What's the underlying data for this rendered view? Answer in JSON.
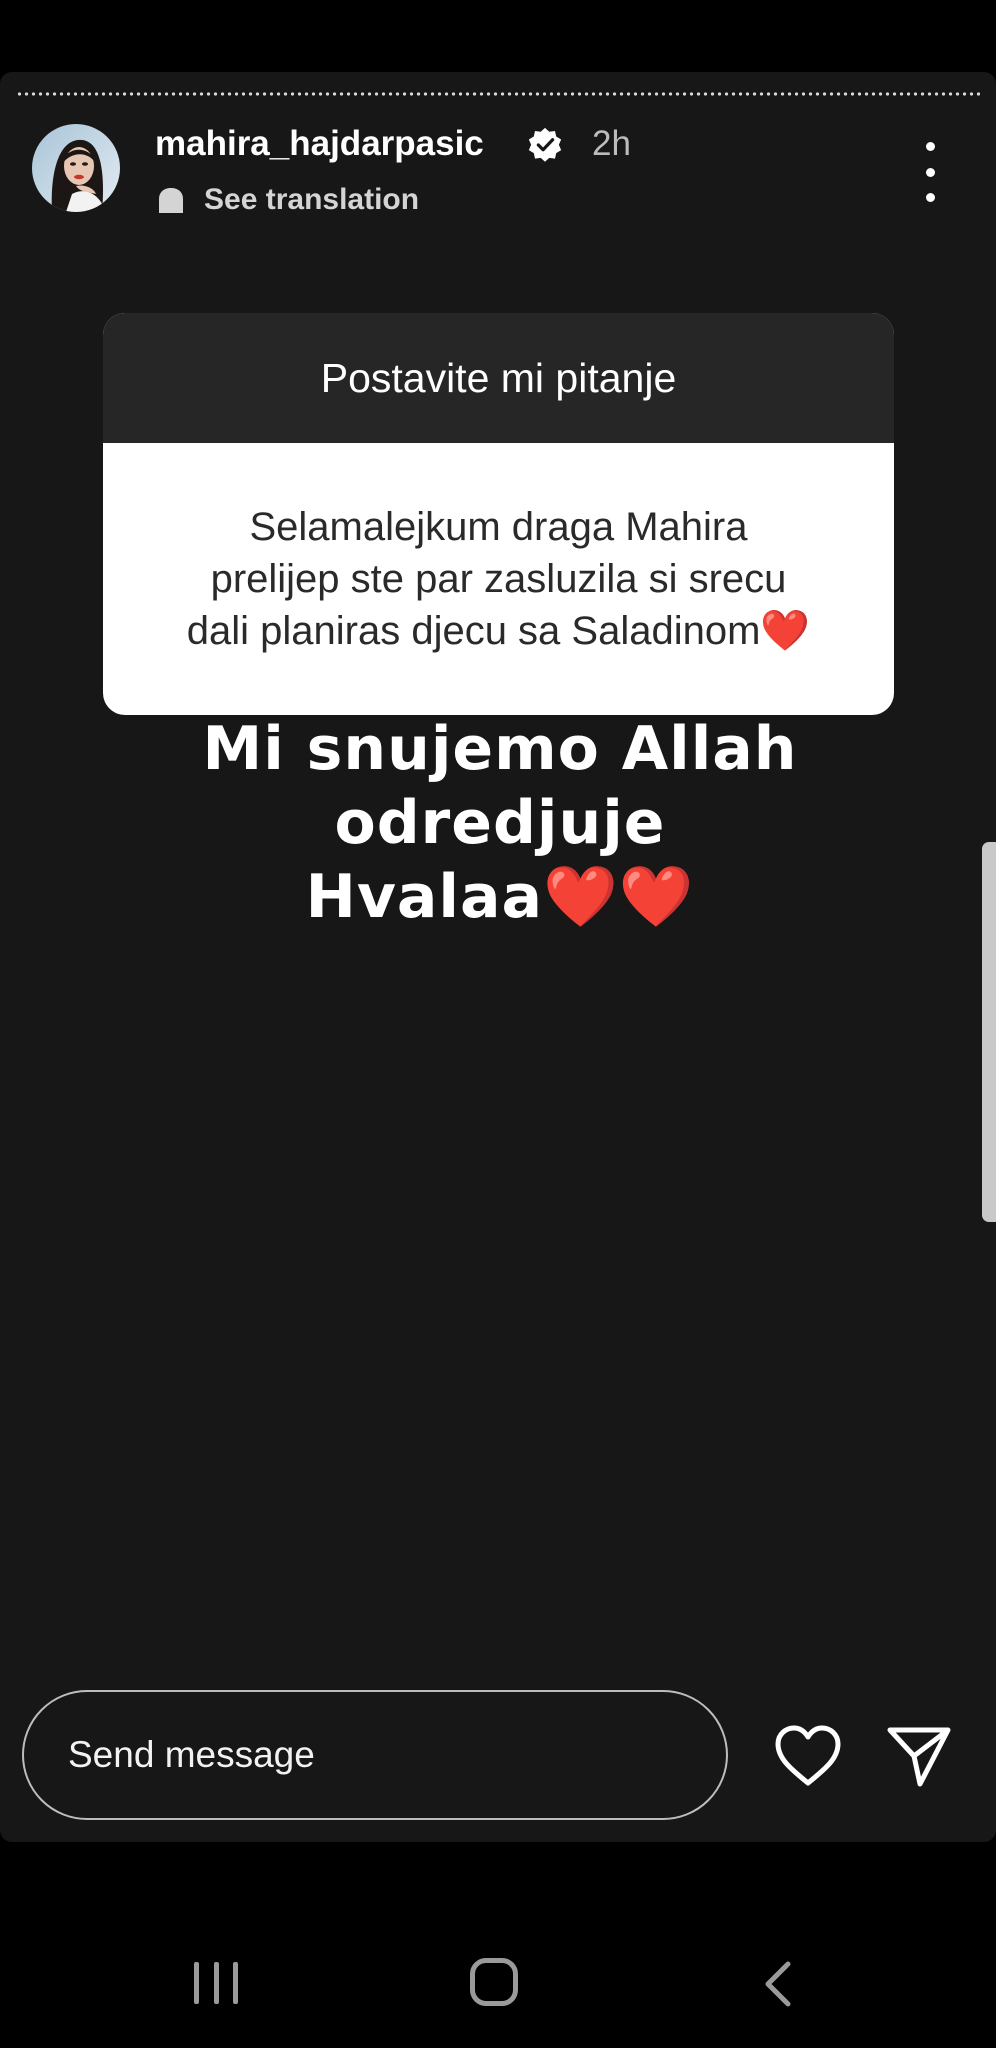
{
  "header": {
    "username": "mahira_hajdarpasic",
    "time": "2h",
    "translation_label": "See translation",
    "menu_icon": "more-vertical-icon",
    "verified_icon": "verified-badge-icon"
  },
  "question_sticker": {
    "title": "Postavite mi pitanje",
    "question_lines": [
      "Selamalejkum draga Mahira",
      "prelijep ste par zasluzila si srecu",
      "dali planiras djecu sa Saladinom❤️"
    ]
  },
  "answer": {
    "lines": [
      "Mi snujemo Allah",
      "odredjuje",
      "Hvalaa❤️❤️"
    ]
  },
  "footer": {
    "message_placeholder": "Send message",
    "like_icon": "heart-icon",
    "send_icon": "paper-plane-icon"
  },
  "colors": {
    "story_background": "#171717",
    "sticker_header": "#262626",
    "sticker_body": "#ffffff",
    "heart_red": "#e0202d",
    "page_background": "#000000"
  }
}
